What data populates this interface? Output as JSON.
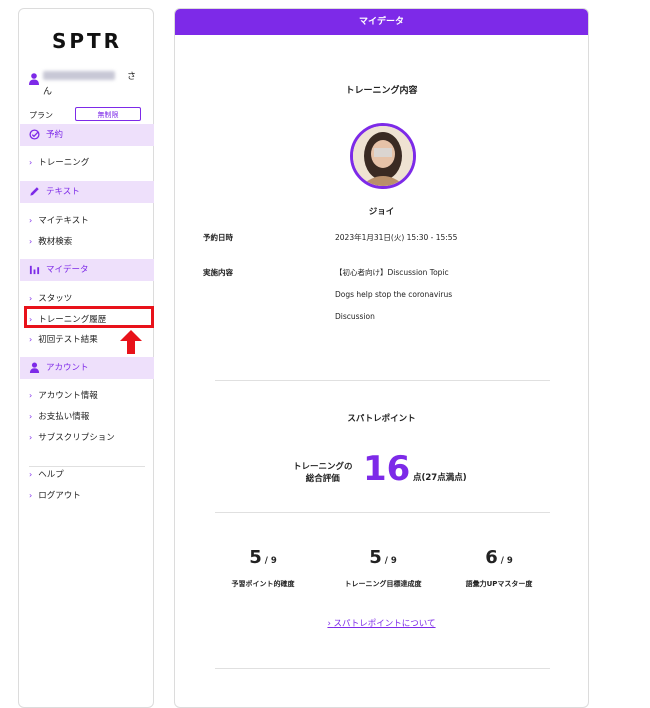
{
  "brand": {
    "logo": "SPTR"
  },
  "user": {
    "suffix": "さ",
    "suffix2": "ん",
    "name": ""
  },
  "plan": {
    "label": "プラン",
    "badge": "無制限"
  },
  "sidebar": {
    "sections": [
      {
        "label": "予約",
        "icon": "check-circle-icon"
      },
      {
        "label": "テキスト",
        "icon": "pencil-icon"
      },
      {
        "label": "マイデータ",
        "icon": "bar-chart-icon"
      },
      {
        "label": "アカウント",
        "icon": "user-icon"
      }
    ],
    "reservation": [
      "トレーニング"
    ],
    "text": [
      "マイテキスト",
      "教材検索"
    ],
    "mydata": [
      "スタッツ",
      "トレーニング履歴",
      "初回テスト結果"
    ],
    "account": [
      "アカウント情報",
      "お支払い情報",
      "サブスクリプション"
    ],
    "other": [
      "ヘルプ",
      "ログアウト"
    ]
  },
  "main": {
    "header": "マイデータ",
    "training_title": "トレーニング内容",
    "teacher_name": "ジョイ",
    "reservation_label": "予約日時",
    "reservation_value": "2023年1月31日(火) 15:30 - 15:55",
    "content_label": "実施内容",
    "content_lines": [
      "【初心者向け】Discussion Topic",
      "Dogs help stop the coronavirus",
      "Discussion"
    ],
    "points_title": "スパトレポイント",
    "score_label_1": "トレーニングの",
    "score_label_2": "総合評価",
    "score_value": "16",
    "score_max": "点(27点満点)",
    "metrics": [
      {
        "value": "5",
        "denom": "/ 9",
        "label": "予習ポイント的確度"
      },
      {
        "value": "5",
        "denom": "/ 9",
        "label": "トレーニング目標達成度"
      },
      {
        "value": "6",
        "denom": "/ 9",
        "label": "語彙力UPマスター度"
      }
    ],
    "about_link": "スパトレポイントについて"
  },
  "colors": {
    "accent": "#7d2ae8",
    "section_bg": "#eee0fb",
    "highlight": "#e8121a"
  }
}
